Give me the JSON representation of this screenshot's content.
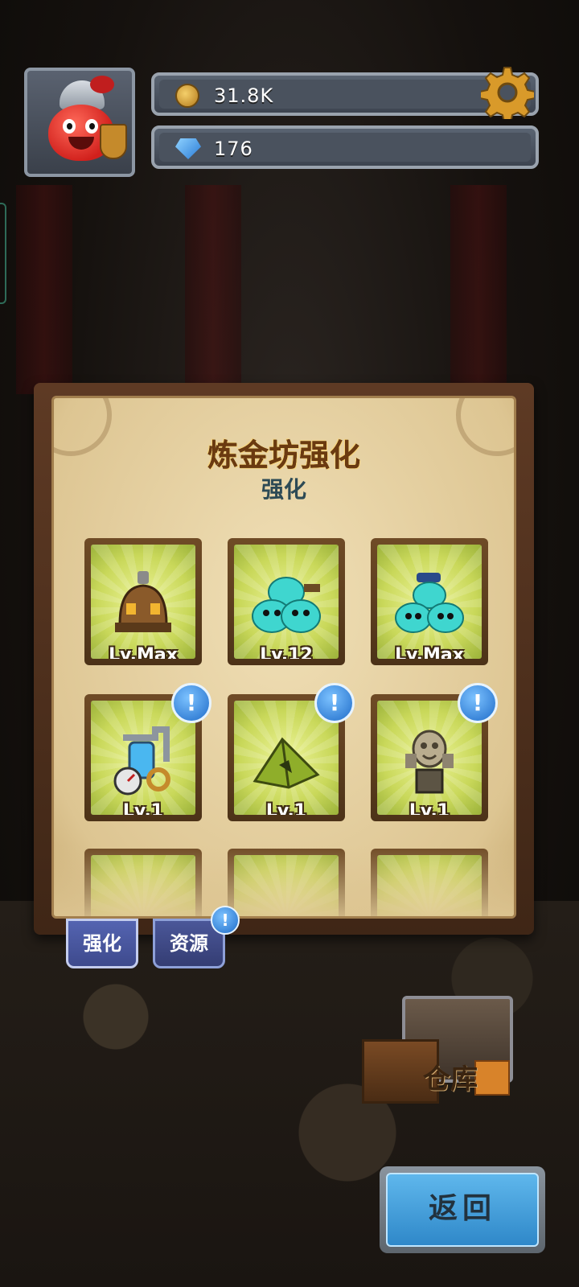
{
  "hud": {
    "coins": "31.8K",
    "gems": "176",
    "coin_icon": "coin-icon",
    "gem_icon": "gem-icon",
    "settings_icon": "gear-icon"
  },
  "panel": {
    "title": "炼金坊强化",
    "subtitle": "强化",
    "items": [
      {
        "level": "Lv.Max",
        "icon": "alchemy-furnace-icon",
        "badge": false
      },
      {
        "level": "Lv.12",
        "icon": "slime-miners-icon",
        "badge": false
      },
      {
        "level": "Lv.Max",
        "icon": "slime-workers-icon",
        "badge": false
      },
      {
        "level": "Lv.1",
        "icon": "pipe-gauge-machine-icon",
        "badge": true
      },
      {
        "level": "Lv.1",
        "icon": "tent-icon",
        "badge": true
      },
      {
        "level": "Lv.1",
        "icon": "slime-statue-icon",
        "badge": true
      },
      {
        "level": "",
        "icon": "rope-coil-icon",
        "badge": false
      },
      {
        "level": "",
        "icon": "potion-flask-icon",
        "badge": false
      },
      {
        "level": "",
        "icon": "rock-icon",
        "badge": false
      }
    ],
    "badge_text": "!"
  },
  "tabs": [
    {
      "label": "强化",
      "active": true
    },
    {
      "label": "资源",
      "active": false
    }
  ],
  "warehouse_label": "仓库",
  "back_button": "返回",
  "colors": {
    "title": "#6b3a10",
    "subtitle": "#2d4a55",
    "badge": "#1f6cc9",
    "back_button": "#2f88c9"
  }
}
